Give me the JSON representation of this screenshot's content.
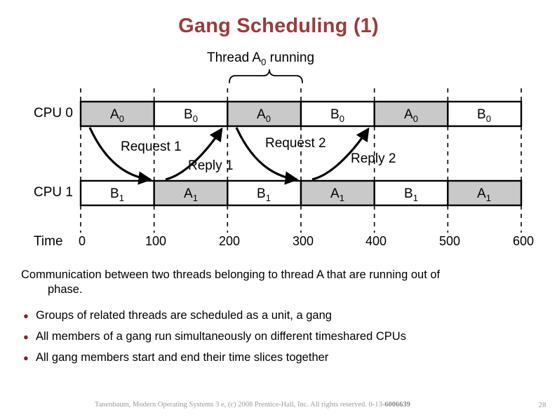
{
  "slide": {
    "title": "Gang Scheduling (1)",
    "title_color": "#9c3b3b",
    "page_number": "28"
  },
  "figure": {
    "callout": {
      "text_prefix": "Thread A",
      "text_sub": "0",
      "text_suffix": " running"
    },
    "rows": [
      {
        "label": "CPU 0",
        "cells": [
          {
            "base": "A",
            "sub": "0",
            "shaded": true
          },
          {
            "base": "B",
            "sub": "0",
            "shaded": false
          },
          {
            "base": "A",
            "sub": "0",
            "shaded": true
          },
          {
            "base": "B",
            "sub": "0",
            "shaded": false
          },
          {
            "base": "A",
            "sub": "0",
            "shaded": true
          },
          {
            "base": "B",
            "sub": "0",
            "shaded": false
          }
        ]
      },
      {
        "label": "CPU 1",
        "cells": [
          {
            "base": "B",
            "sub": "1",
            "shaded": false
          },
          {
            "base": "A",
            "sub": "1",
            "shaded": true
          },
          {
            "base": "B",
            "sub": "1",
            "shaded": false
          },
          {
            "base": "A",
            "sub": "1",
            "shaded": true
          },
          {
            "base": "B",
            "sub": "1",
            "shaded": false
          },
          {
            "base": "A",
            "sub": "1",
            "shaded": true
          }
        ]
      }
    ],
    "annotations": [
      {
        "name": "request-1",
        "text": "Request 1"
      },
      {
        "name": "reply-1",
        "text": "Reply 1"
      },
      {
        "name": "request-2",
        "text": "Request 2"
      },
      {
        "name": "reply-2",
        "text": "Reply 2"
      }
    ],
    "axis": {
      "label": "Time",
      "ticks": [
        "0",
        "100",
        "200",
        "300",
        "400",
        "500",
        "600"
      ]
    },
    "colors": {
      "shaded_cell": "#c9c9c9",
      "unshaded_cell": "#ffffff",
      "stroke": "#000000"
    }
  },
  "body": {
    "intro_line1": "Communication between two threads belonging to thread A that are running out of",
    "intro_line2": "phase.",
    "bullet_marker": "●",
    "bullets": [
      "Groups of related threads are scheduled as a unit, a gang",
      "All members of a gang run simultaneously on different timeshared CPUs",
      "All gang members start and end their time slices together"
    ]
  },
  "footer": {
    "credit_text": "Tanenbaum, Modern Operating Systems 3 e, (c) 2008 Prentice-Hall, Inc. All rights reserved. 0-13-",
    "isbn_bold": "6006639"
  }
}
